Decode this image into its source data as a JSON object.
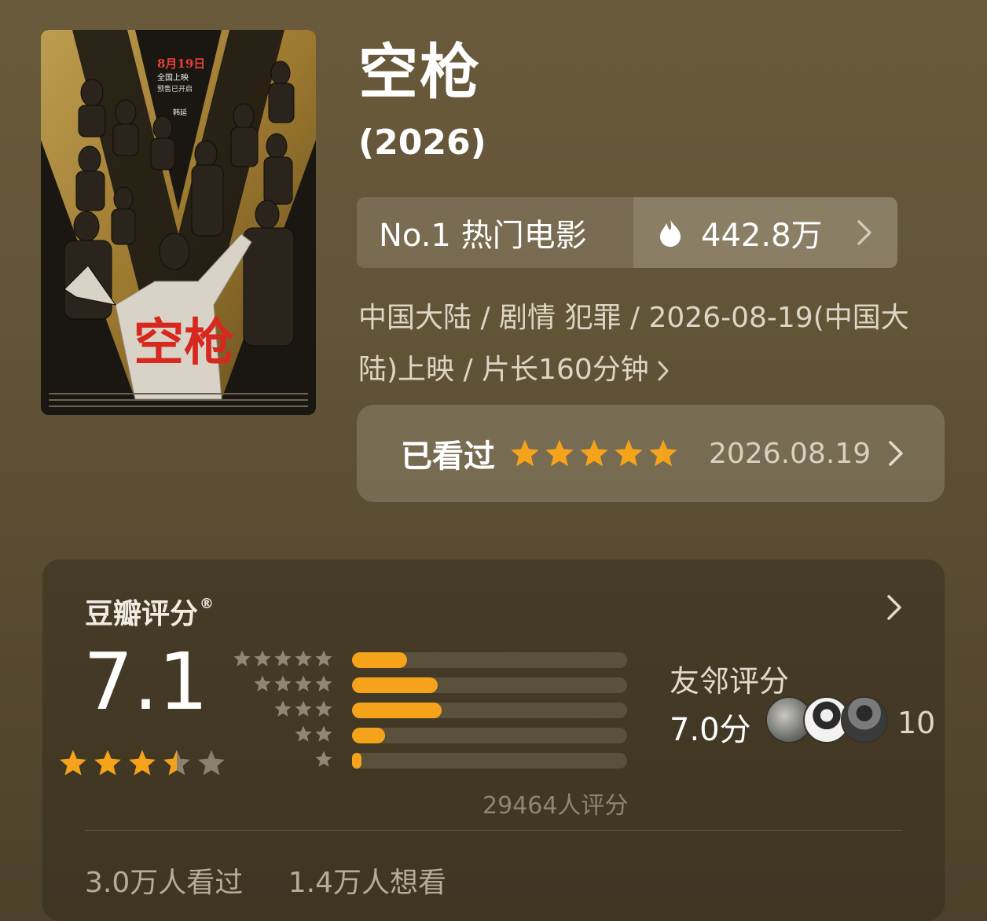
{
  "poster": {
    "release_line1": "8月19日",
    "release_line2": "全国上映",
    "release_line3": "预售已开启",
    "title_art": "空枪",
    "name_tag": "韩延"
  },
  "movie": {
    "title": "空枪",
    "year": "(2026)"
  },
  "rank": {
    "label": "No.1 热门电影",
    "heat": "442.8万",
    "heat_icon": "flame-icon"
  },
  "meta": {
    "line1": "中国大陆 / 剧情 犯罪 / 2026-08-19(中国大",
    "line2": "陆)上映 / 片长160分钟"
  },
  "watched": {
    "label": "已看过",
    "user_stars": 5,
    "date": "2026.08.19"
  },
  "rating": {
    "title": "豆瓣评分",
    "registered": "®",
    "score": "7.1",
    "stars": 3.5,
    "distribution": [
      {
        "stars": 5,
        "fraction": 0.2
      },
      {
        "stars": 4,
        "fraction": 0.31
      },
      {
        "stars": 3,
        "fraction": 0.325
      },
      {
        "stars": 2,
        "fraction": 0.12
      },
      {
        "stars": 1,
        "fraction": 0.035
      }
    ],
    "count": "29464人评分",
    "friends_label": "友邻评分",
    "friends_score": "7.0分",
    "friends_count": "10"
  },
  "footer": {
    "watched": "3.0万人看过",
    "want": "1.4万人想看"
  },
  "colors": {
    "accent": "#f5a31b",
    "background": "#625437"
  }
}
